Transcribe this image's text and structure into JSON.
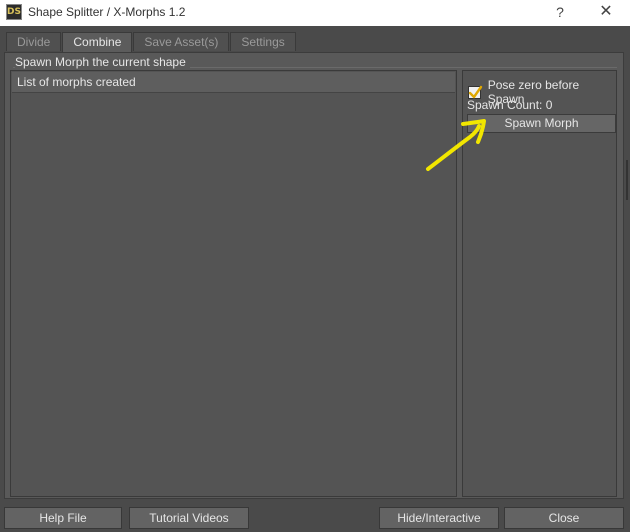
{
  "window": {
    "title": "Shape Splitter / X-Morphs 1.2",
    "app_icon_text": "DS",
    "help_glyph": "?",
    "close_glyph": "✕"
  },
  "tabs": [
    {
      "label": "Divide",
      "active": false
    },
    {
      "label": "Combine",
      "active": true
    },
    {
      "label": "Save Asset(s)",
      "active": false
    },
    {
      "label": "Settings",
      "active": false
    }
  ],
  "group": {
    "legend": "Spawn Morph the current shape"
  },
  "morph_list": {
    "header": "List of morphs created",
    "items": []
  },
  "side_panel": {
    "pose_zero_label": "Pose zero before Spawn",
    "pose_zero_checked": true,
    "spawn_count_text": "Spawn Count: 0",
    "spawn_button_label": "Spawn Morph"
  },
  "bottom_bar": {
    "help_file": "Help File",
    "tutorial_videos": "Tutorial Videos",
    "hide_interactive": "Hide/Interactive",
    "close": "Close"
  },
  "colors": {
    "annotation": "#f2e600",
    "checkmark": "#e0a800"
  }
}
